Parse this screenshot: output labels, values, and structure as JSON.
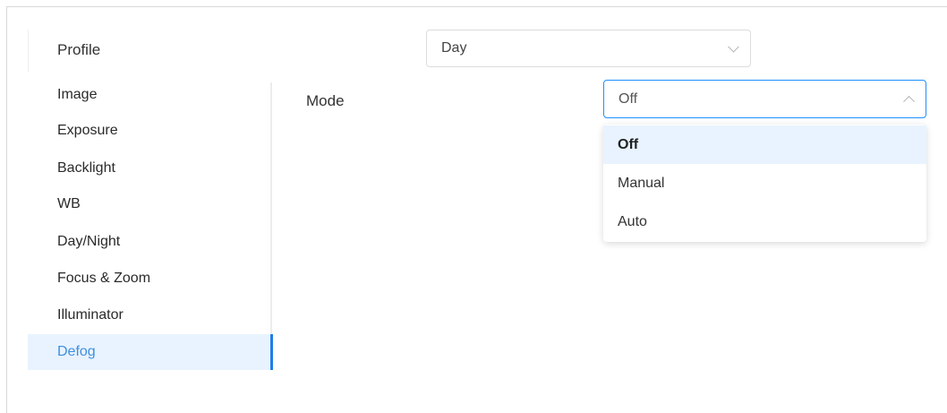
{
  "profile": {
    "label": "Profile",
    "selected": "Day"
  },
  "menu": {
    "items": [
      {
        "label": "Image"
      },
      {
        "label": "Exposure"
      },
      {
        "label": "Backlight"
      },
      {
        "label": "WB"
      },
      {
        "label": "Day/Night"
      },
      {
        "label": "Focus & Zoom"
      },
      {
        "label": "Illuminator"
      },
      {
        "label": "Defog"
      }
    ],
    "active_index": 7
  },
  "mode": {
    "label": "Mode",
    "selected": "Off",
    "options": [
      "Off",
      "Manual",
      "Auto"
    ]
  },
  "colors": {
    "accent": "#1e7fe8",
    "active_bg": "#e8f3ff",
    "active_text": "#3f8fe0"
  },
  "icons": {
    "profile_select": "chevron-down-icon",
    "mode_select": "chevron-up-icon"
  }
}
